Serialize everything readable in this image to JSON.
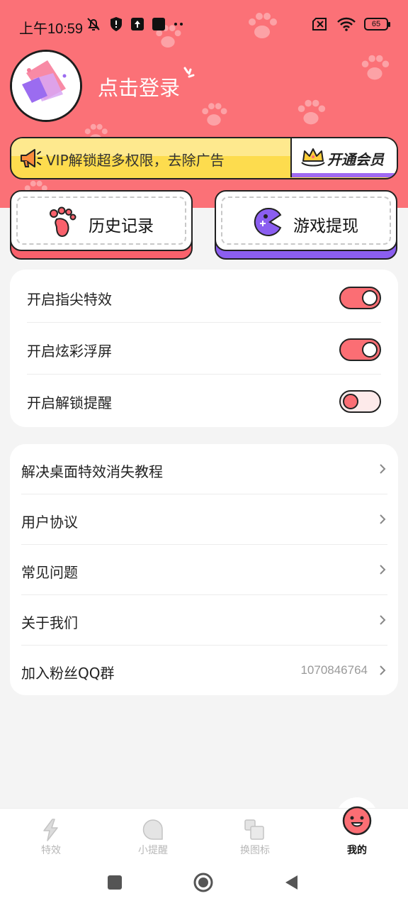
{
  "status_bar": {
    "time": "上午10:59",
    "battery": "65"
  },
  "profile": {
    "login_label": "点击登录"
  },
  "vip": {
    "text": "VIP解锁超多权限，去除广告",
    "button_label": "开通会员"
  },
  "quick_actions": [
    {
      "label": "历史记录",
      "icon": "footprint-icon"
    },
    {
      "label": "游戏提现",
      "icon": "game-pacman-icon"
    }
  ],
  "toggles": [
    {
      "label": "开启指尖特效",
      "state": "on"
    },
    {
      "label": "开启炫彩浮屏",
      "state": "on"
    },
    {
      "label": "开启解锁提醒",
      "state": "off"
    }
  ],
  "menu": [
    {
      "label": "解决桌面特效消失教程",
      "value": ""
    },
    {
      "label": "用户协议",
      "value": ""
    },
    {
      "label": "常见问题",
      "value": ""
    },
    {
      "label": "关于我们",
      "value": ""
    },
    {
      "label": "加入粉丝QQ群",
      "value": "1070846764"
    }
  ],
  "tabs": [
    {
      "label": "特效",
      "icon": "lightning-icon",
      "active": false
    },
    {
      "label": "小提醒",
      "icon": "bubble-icon",
      "active": false
    },
    {
      "label": "换图标",
      "icon": "image-swap-icon",
      "active": false
    },
    {
      "label": "我的",
      "icon": "smiley-face-icon",
      "active": true
    }
  ],
  "colors": {
    "header": "#fb7177",
    "vip_yellow": "#fddc4e",
    "history_accent": "#f9616c",
    "game_accent": "#8b5ef0",
    "switch_on": "#fb6e74"
  }
}
